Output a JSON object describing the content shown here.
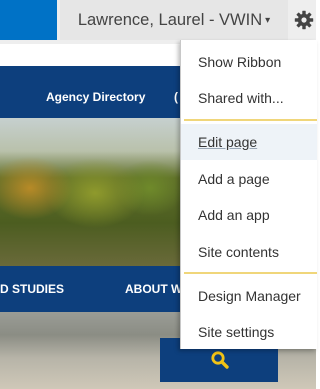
{
  "topbar": {
    "user_name": "Lawrence, Laurel - VWIN",
    "caret": "▾",
    "gear_icon": "gear-icon",
    "brand_color": "#0072c6"
  },
  "site_nav": {
    "top_link": "Agency Directory",
    "top_link_partial": "(",
    "mid_left": "D STUDIES",
    "mid_right": "ABOUT W",
    "band_color": "#0d3f7d"
  },
  "search": {
    "icon": "search-icon",
    "icon_color": "#f2c316"
  },
  "settings_menu": {
    "items": [
      {
        "label": "Show Ribbon"
      },
      {
        "label": "Shared with..."
      },
      {
        "label": "Edit page"
      },
      {
        "label": "Add a page"
      },
      {
        "label": "Add an app"
      },
      {
        "label": "Site contents"
      },
      {
        "label": "Design Manager"
      },
      {
        "label": "Site settings"
      }
    ],
    "separator_color": "#f0d67a",
    "hover_background": "#eef3f8"
  }
}
